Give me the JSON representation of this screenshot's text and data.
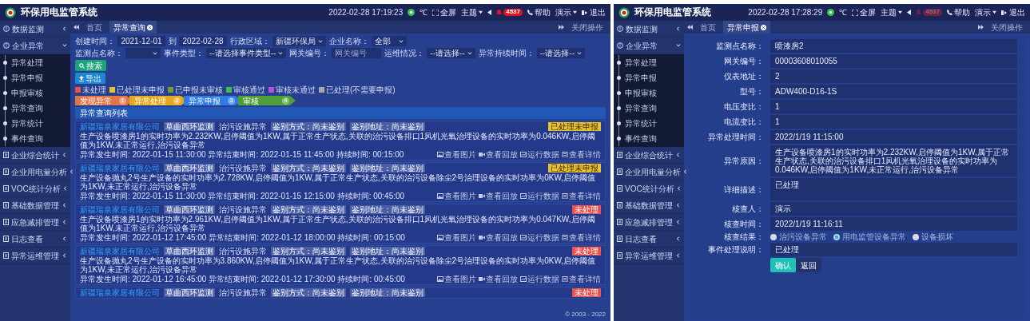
{
  "screens": [
    {
      "header": {
        "title": "环保用电监管系统",
        "datetime": "2022-02-28 17:19:23",
        "temperature_unit": "℃",
        "tools": [
          {
            "kind": "fullscreen",
            "label": "全屏"
          },
          {
            "kind": "dropdown",
            "label": "主题"
          },
          {
            "kind": "arrow"
          },
          {
            "kind": "alerts",
            "label": "4537",
            "muted": false
          },
          {
            "kind": "help",
            "label": "帮助"
          },
          {
            "kind": "dropdown",
            "label": "演示"
          },
          {
            "kind": "logout",
            "label": "退出"
          }
        ]
      },
      "sidebar": [
        {
          "label": "数据监测",
          "expanded": false
        },
        {
          "label": "企业异常",
          "expanded": true,
          "children": [
            {
              "label": "异常处理",
              "selected": false
            },
            {
              "label": "异常申报",
              "selected": false
            },
            {
              "label": "申报审核",
              "selected": false
            },
            {
              "label": "异常查询",
              "selected": false
            },
            {
              "label": "异常统计",
              "selected": false
            },
            {
              "label": "事件查询",
              "selected": false
            }
          ]
        },
        {
          "label": "企业综合统计",
          "expanded": false
        },
        {
          "label": "企业用电量分析",
          "expanded": false
        },
        {
          "label": "VOC统计分析",
          "expanded": false
        },
        {
          "label": "基础数据管理",
          "expanded": false
        },
        {
          "label": "应急减排管理",
          "expanded": false
        },
        {
          "label": "日志查看",
          "expanded": false
        },
        {
          "label": "异常运维管理",
          "expanded": false
        }
      ],
      "tabs": {
        "items": [
          {
            "label": "首页",
            "selected": false,
            "closable": false
          },
          {
            "label": "异常查询",
            "selected": true,
            "closable": true
          }
        ],
        "close_all": "关闭操作"
      },
      "content": {
        "kind": "query",
        "filters": [
          {
            "kind": "date",
            "label": "创建时间：",
            "value": "2021-12-01"
          },
          {
            "kind": "date",
            "label": "到",
            "value": "2022-02-28"
          },
          {
            "kind": "select",
            "label": "行政区域：",
            "value": "新疆环保局"
          },
          {
            "kind": "select",
            "label": "企业名称：",
            "value": "全部"
          },
          {
            "kind": "select",
            "label": "监测点名称："
          },
          {
            "kind": "select",
            "label": "事件类型：",
            "value": "--请选择事件类型--"
          },
          {
            "kind": "text",
            "label": "网关编号：",
            "placeholder": "网关编号"
          },
          {
            "kind": "select",
            "label": "运维情况：",
            "value": "--请选择--"
          },
          {
            "kind": "select",
            "label": "异常持续时间：",
            "value": "--请选择--"
          }
        ],
        "search_button": "搜索",
        "export_button": "导出",
        "legend": [
          {
            "label": "未处理",
            "color": "#e9534f"
          },
          {
            "label": "已处理未申报",
            "color": "#e8c12f"
          },
          {
            "label": "已申报未审核",
            "color": "#7a9a3a"
          },
          {
            "label": "审核通过",
            "color": "#3fbf4f"
          },
          {
            "label": "审核未通过",
            "color": "#b455d6"
          },
          {
            "label": "已处理(不需要申报)",
            "color": "#a9a9a9"
          }
        ],
        "steps": [
          {
            "label": "发现异常",
            "number": "1",
            "color": "#e0744a"
          },
          {
            "label": "异常处理",
            "number": "2",
            "color": "#e6a81f"
          },
          {
            "label": "异常申报",
            "number": "3",
            "color": "#2f7be8"
          },
          {
            "label": "审核",
            "number": "4",
            "color": "#4e9e3a"
          }
        ],
        "list_title": "异常查询列表",
        "records": [
          {
            "company": "新疆瑞泉家居有限公司",
            "site": "草曲西环监测",
            "type": "治污设施异常",
            "method": "鉴别方式：尚未鉴别",
            "address": "鉴别地址：尚未鉴别",
            "status": {
              "label": "已处理未申报",
              "color": "#e8c12f"
            },
            "description": "生产设备喷漆房1的实时功率为2.232KW,启停阈值为1KW,属于正常生产状态,关联的治污设备排口1风机光氧治理设备的实时功率为0.046KW,启停阈值为1KW,未正常运行,治污设备异常",
            "times": "异常发生时间: 2022-01-15 11:30:00 异常结束时间: 2022-01-15 11:45:00 持续时间: 00:15:00",
            "actions": [
              "查看图片",
              "查看回放",
              "运行数据",
              "查看详情"
            ]
          },
          {
            "company": "新疆瑞泉家居有限公司",
            "site": "草曲西环监测",
            "type": "治污设施异常",
            "method": "鉴别方式：尚未鉴别",
            "address": "鉴别地址：尚未鉴别",
            "status": {
              "label": "已处理未申报",
              "color": "#e8c12f"
            },
            "description": "生产设备抛丸2号生产设备的实时功率为2.728KW,启停阈值为1KW,属于正常生产状态,关联的治污设备除尘2号治理设备的实时功率为0KW,启停阈值为1KW,未正常运行,治污设备异常",
            "times": "异常发生时间: 2022-01-15 11:30:00 异常结束时间: 2022-01-15 12:15:00 持续时间: 00:45:00",
            "actions": [
              "查看图片",
              "查看回放",
              "运行数据",
              "查看详情"
            ]
          },
          {
            "company": "新疆瑞泉家居有限公司",
            "site": "草曲西环监测",
            "type": "治污设施异常",
            "method": "鉴别方式：尚未鉴别",
            "address": "鉴别地址：尚未鉴别",
            "status": {
              "label": "未处理",
              "color": "#e9534f"
            },
            "description": "生产设备喷漆房1的实时功率为2.961KW,启停阈值为1KW,属于正常生产状态,关联的治污设备排口1风机光氧治理设备的实时功率为0.047KW,启停阈值为1KW,未正常运行,治污设备异常",
            "times": "异常发生时间: 2022-01-12 17:45:00 异常结束时间: 2022-01-12 18:00:00 持续时间: 00:15:00",
            "actions": [
              "查看图片",
              "查看回放",
              "运行数据",
              "查看详情"
            ]
          },
          {
            "company": "新疆瑞泉家居有限公司",
            "site": "草曲西环监测",
            "type": "治污设施异常",
            "method": "鉴别方式：尚未鉴别",
            "address": "鉴别地址：尚未鉴别",
            "status": {
              "label": "未处理",
              "color": "#e9534f"
            },
            "description": "生产设备抛丸2号生产设备的实时功率为3.860KW,启停阈值为1KW,属于正常生产状态,关联的治污设备除尘2号治理设备的实时功率为0KW,启停阈值为1KW,未正常运行,治污设备异常",
            "times": "异常发生时间: 2022-01-12 16:45:00 异常结束时间: 2022-01-12 17:30:00 持续时间: 00:45:00",
            "actions": [
              "查看图片",
              "查看回放",
              "运行数据",
              "查看详情"
            ]
          },
          {
            "company": "新疆瑞泉家居有限公司",
            "site": "草曲西环监测",
            "type": "治污设施异常",
            "method": "鉴别方式：尚未鉴别",
            "address": "鉴别地址：尚未鉴别",
            "status": {
              "label": "未处理",
              "color": "#e9534f"
            }
          }
        ],
        "footer": "© 2003 - 2022"
      }
    },
    {
      "header": {
        "title": "环保用电监管系统",
        "datetime": "2022-02-28 17:28:29",
        "temperature_unit": "℃",
        "tools": [
          {
            "kind": "fullscreen",
            "label": "全屏"
          },
          {
            "kind": "dropdown",
            "label": "主题"
          },
          {
            "kind": "arrow"
          },
          {
            "kind": "alerts",
            "label": "4537",
            "muted": true
          },
          {
            "kind": "help",
            "label": "帮助"
          },
          {
            "kind": "dropdown",
            "label": "演示"
          },
          {
            "kind": "logout",
            "label": "退出"
          }
        ]
      },
      "sidebar": [
        {
          "label": "数据监测",
          "expanded": false
        },
        {
          "label": "企业异常",
          "expanded": true,
          "children": [
            {
              "label": "异常处理",
              "selected": false
            },
            {
              "label": "异常申报",
              "selected": false
            },
            {
              "label": "申报审核",
              "selected": false
            },
            {
              "label": "异常查询",
              "selected": false
            },
            {
              "label": "异常统计",
              "selected": false
            },
            {
              "label": "事件查询",
              "selected": false
            }
          ]
        },
        {
          "label": "企业综合统计",
          "expanded": false
        },
        {
          "label": "企业用电量分析",
          "expanded": false
        },
        {
          "label": "VOC统计分析",
          "expanded": false
        },
        {
          "label": "基础数据管理",
          "expanded": false
        },
        {
          "label": "应急减排管理",
          "expanded": false
        },
        {
          "label": "日志查看",
          "expanded": false
        },
        {
          "label": "异常运维管理",
          "expanded": false
        }
      ],
      "tabs": {
        "items": [
          {
            "label": "首页",
            "selected": false,
            "closable": false
          },
          {
            "label": "异常申报",
            "selected": true,
            "closable": true
          }
        ],
        "close_all": "关闭操作"
      },
      "content": {
        "kind": "form",
        "fields": [
          {
            "kind": "input",
            "label": "监测点名称：",
            "value": "喷漆房2"
          },
          {
            "kind": "input",
            "label": "网关编号：",
            "value": "00003608010055"
          },
          {
            "kind": "input",
            "label": "仪表地址：",
            "value": "2"
          },
          {
            "kind": "input",
            "label": "型号：",
            "value": "ADW400-D16-1S"
          },
          {
            "kind": "input",
            "label": "电压变比：",
            "value": "1"
          },
          {
            "kind": "input",
            "label": "电流变比：",
            "value": "1"
          },
          {
            "kind": "input",
            "label": "异常处理时间：",
            "value": "2022/1/19 11:15:00"
          },
          {
            "kind": "textarea",
            "label": "异常原因：",
            "value": "生产设备喷漆房1的实时功率为2.232KW,启停阈值为1KW,属于正常生产状态,关联的治污设备排口1风机光氧治理设备的实时功率为0.046KW,启停阈值为1KW,未正常运行,治污设备异常"
          },
          {
            "kind": "textarea",
            "label": "详细描述：",
            "value": "已处理"
          },
          {
            "kind": "input",
            "label": "核查人：",
            "value": "演示"
          },
          {
            "kind": "input",
            "label": "核查时间：",
            "value": "2022/1/19 11:16:11"
          },
          {
            "kind": "radio",
            "label": "核查结果：",
            "options": [
              {
                "label": "治污设备异常",
                "selected": false
              },
              {
                "label": "用电监管设备异常",
                "selected": true
              },
              {
                "label": "设备损坏",
                "selected": false
              }
            ]
          },
          {
            "kind": "input",
            "label": "事件处理说明：",
            "value": "已处理"
          }
        ],
        "buttons": [
          {
            "kind": "primary",
            "label": "确认"
          },
          {
            "kind": "secondary",
            "label": "返回"
          }
        ]
      }
    }
  ]
}
